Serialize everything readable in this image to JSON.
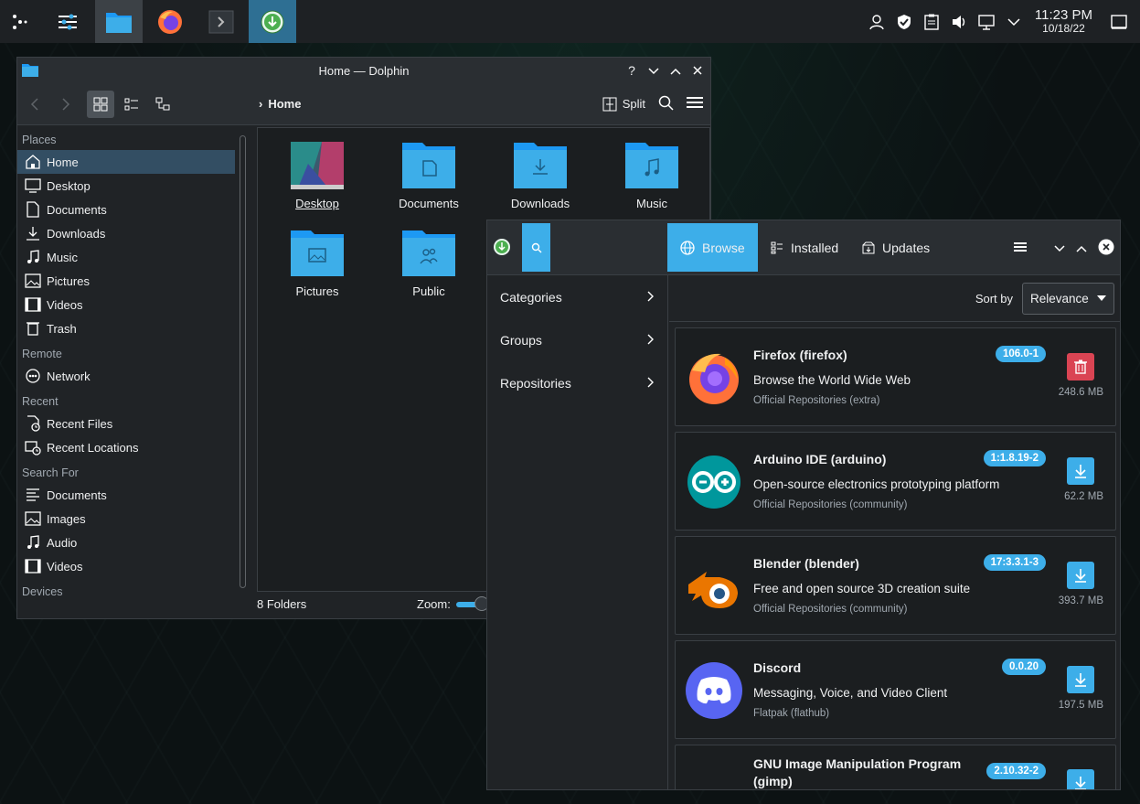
{
  "taskbar": {
    "clock_time": "11:23 PM",
    "clock_date": "10/18/22"
  },
  "dolphin": {
    "title": "Home — Dolphin",
    "breadcrumb": "Home",
    "split_label": "Split",
    "places": [
      {
        "type": "header",
        "label": "Places"
      },
      {
        "type": "item",
        "label": "Home",
        "icon": "home-icon",
        "active": true
      },
      {
        "type": "item",
        "label": "Desktop",
        "icon": "desktop-icon"
      },
      {
        "type": "item",
        "label": "Documents",
        "icon": "documents-icon"
      },
      {
        "type": "item",
        "label": "Downloads",
        "icon": "downloads-icon"
      },
      {
        "type": "item",
        "label": "Music",
        "icon": "music-icon"
      },
      {
        "type": "item",
        "label": "Pictures",
        "icon": "pictures-icon"
      },
      {
        "type": "item",
        "label": "Videos",
        "icon": "videos-icon"
      },
      {
        "type": "item",
        "label": "Trash",
        "icon": "trash-icon"
      },
      {
        "type": "header",
        "label": "Remote"
      },
      {
        "type": "item",
        "label": "Network",
        "icon": "network-icon"
      },
      {
        "type": "header",
        "label": "Recent"
      },
      {
        "type": "item",
        "label": "Recent Files",
        "icon": "recent-files-icon"
      },
      {
        "type": "item",
        "label": "Recent Locations",
        "icon": "recent-locations-icon"
      },
      {
        "type": "header",
        "label": "Search For"
      },
      {
        "type": "item",
        "label": "Documents",
        "icon": "documents-search-icon"
      },
      {
        "type": "item",
        "label": "Images",
        "icon": "images-icon"
      },
      {
        "type": "item",
        "label": "Audio",
        "icon": "audio-icon"
      },
      {
        "type": "item",
        "label": "Videos",
        "icon": "videos-icon"
      },
      {
        "type": "header",
        "label": "Devices"
      }
    ],
    "folders": [
      "Desktop",
      "Documents",
      "Downloads",
      "Music",
      "Pictures",
      "Public"
    ],
    "status": "8 Folders",
    "zoom_label": "Zoom:"
  },
  "discover": {
    "tabs": {
      "browse": "Browse",
      "installed": "Installed",
      "updates": "Updates"
    },
    "sidebar": [
      "Categories",
      "Groups",
      "Repositories"
    ],
    "sort_label": "Sort by",
    "sort_value": "Relevance",
    "apps": [
      {
        "name": "Firefox (firefox)",
        "desc": "Browse the World Wide Web",
        "repo": "Official Repositories (extra)",
        "version": "106.0-1",
        "size": "248.6 MB",
        "installed": true
      },
      {
        "name": "Arduino IDE (arduino)",
        "desc": "Open-source electronics prototyping platform",
        "repo": "Official Repositories (community)",
        "version": "1:1.8.19-2",
        "size": "62.2 MB",
        "installed": false
      },
      {
        "name": "Blender (blender)",
        "desc": "Free and open source 3D creation suite",
        "repo": "Official Repositories (community)",
        "version": "17:3.3.1-3",
        "size": "393.7 MB",
        "installed": false
      },
      {
        "name": "Discord",
        "desc": "Messaging, Voice, and Video Client",
        "repo": "Flatpak (flathub)",
        "version": "0.0.20",
        "size": "197.5 MB",
        "installed": false
      },
      {
        "name": "GNU Image Manipulation Program (gimp)",
        "desc": "",
        "repo": "",
        "version": "2.10.32-2",
        "size": "",
        "installed": false
      }
    ]
  },
  "colors": {
    "accent": "#3daee9",
    "danger": "#da4453",
    "folder": "#3daee9"
  }
}
